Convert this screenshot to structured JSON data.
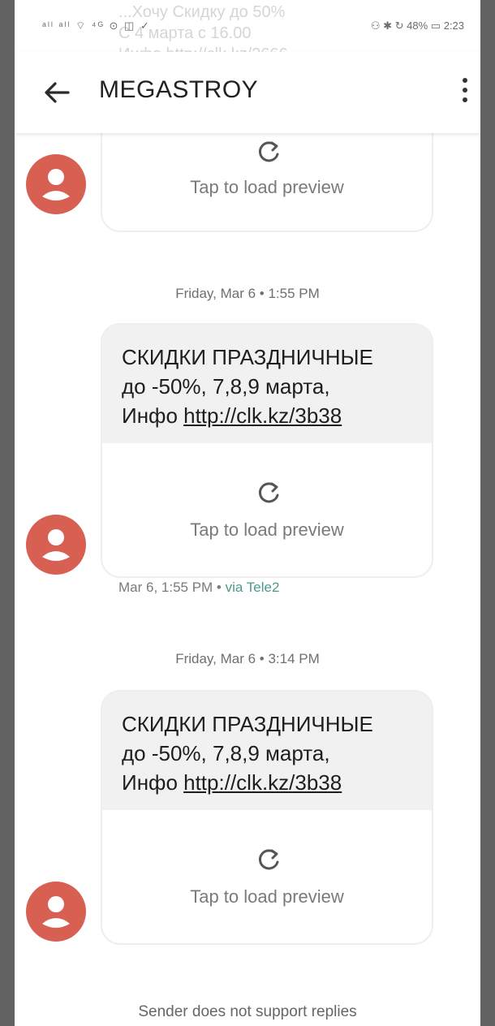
{
  "status": {
    "left_icons": "ᵃˡˡ ᵃˡˡ ⌔ ⁴ᴳ ⊙ ◫ ✓",
    "right_info": "⚇ ✱ ↻ 48% ▭ 2:23",
    "ghost_text": "...Хочу Скидку до 50%\nС 4 марта с 16.00\nИнфо http://clk.kz/2666"
  },
  "appbar": {
    "title": "MEGASTROY"
  },
  "preview_label": "Tap to load preview",
  "dates": [
    "Friday, Mar 6 • 1:55 PM",
    "Friday, Mar 6 • 3:14 PM"
  ],
  "messages": [
    {
      "line1": "СКИДКИ ПРАЗДНИЧНЫЕ",
      "line2": "до -50%, 7,8,9 марта,",
      "prefix": "Инфо ",
      "link": "http://clk.kz/3b38"
    },
    {
      "line1": "СКИДКИ ПРАЗДНИЧНЫЕ",
      "line2": "до -50%, 7,8,9 марта,",
      "prefix": "Инфо ",
      "link": "http://clk.kz/3b38"
    }
  ],
  "meta": {
    "time": "Mar 6, 1:55 PM • ",
    "via": "via Tele2"
  },
  "footer": "Sender does not support replies",
  "colors": {
    "avatar": "#d86052",
    "via": "#4a9c8a"
  }
}
